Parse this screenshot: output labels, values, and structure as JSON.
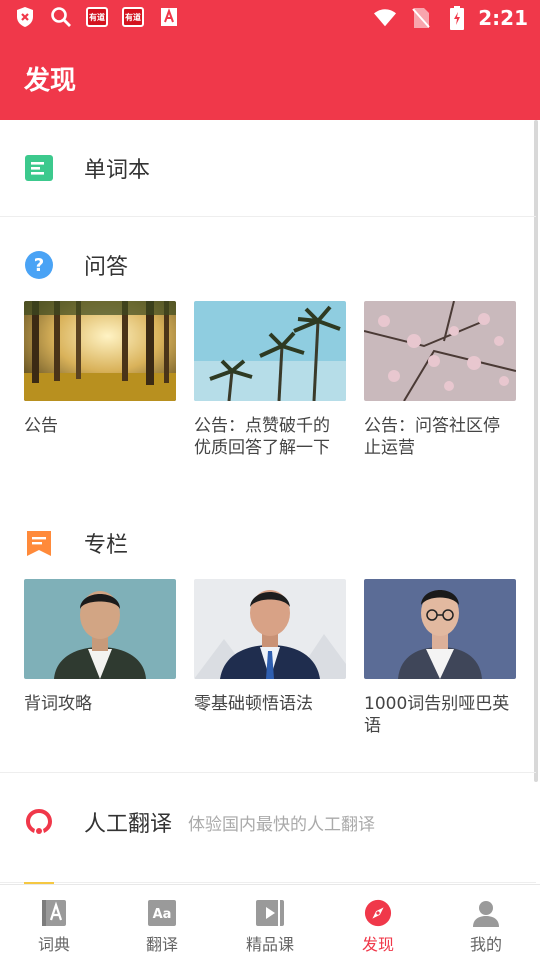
{
  "status_bar": {
    "time": "2:21",
    "app_icon_text": "有道",
    "icons": [
      "shield-icon",
      "search-icon",
      "youdao-app-icon",
      "youdao-app-icon",
      "font-app-icon",
      "wifi-icon",
      "no-sim-icon",
      "battery-charging-icon"
    ]
  },
  "header": {
    "title": "发现"
  },
  "wordbook": {
    "label": "单词本"
  },
  "qa": {
    "label": "问答",
    "cards": [
      {
        "title": "公告"
      },
      {
        "title": "公告：点赞破千的优质回答了解一下"
      },
      {
        "title": "公告：问答社区停止运营"
      }
    ]
  },
  "column": {
    "label": "专栏",
    "cards": [
      {
        "title": "背词攻略"
      },
      {
        "title": "零基础顿悟语法"
      },
      {
        "title": "1000词告别哑巴英语"
      }
    ]
  },
  "human_translation": {
    "label": "人工翻译",
    "subtitle": "体验国内最快的人工翻译"
  },
  "tabs": [
    {
      "label": "词典",
      "icon": "dictionary-icon",
      "active": false
    },
    {
      "label": "翻译",
      "icon": "translate-icon",
      "active": false
    },
    {
      "label": "精品课",
      "icon": "course-icon",
      "active": false
    },
    {
      "label": "发现",
      "icon": "compass-icon",
      "active": true
    },
    {
      "label": "我的",
      "icon": "profile-icon",
      "active": false
    }
  ],
  "colors": {
    "brand": "#f0384a",
    "wordbook_icon": "#3cc98d",
    "qa_icon": "#4aa3f5",
    "column_icon": "#ff8a3a"
  }
}
